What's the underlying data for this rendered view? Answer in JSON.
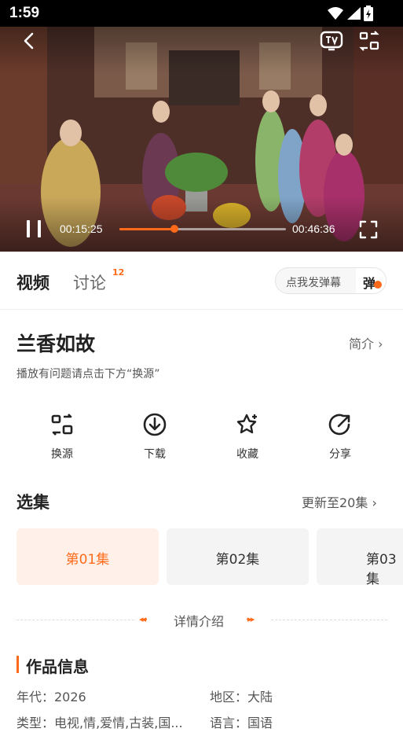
{
  "status_bar": {
    "time": "1:59"
  },
  "player": {
    "current_time": "00:15:25",
    "total_time": "00:46:36",
    "progress": 0.331,
    "accent_color": "#ff6a1a",
    "icons": [
      "back-icon",
      "tv-cast-icon",
      "switch-source-icon",
      "pause-icon",
      "fullscreen-icon"
    ]
  },
  "tabs": {
    "video": "视频",
    "discuss": "讨论",
    "discuss_count": "12"
  },
  "danmu": {
    "placeholder": "点我发弹幕",
    "toggle_label": "弹"
  },
  "show": {
    "title": "兰香如故",
    "intro_label": "简介",
    "intro_arrow": "›",
    "hint": "播放有问题请点击下方“换源”"
  },
  "actions": [
    {
      "label": "换源",
      "icon": "switch-source-icon"
    },
    {
      "label": "下载",
      "icon": "download-icon"
    },
    {
      "label": "收藏",
      "icon": "star-add-icon"
    },
    {
      "label": "分享",
      "icon": "share-icon"
    }
  ],
  "episodes": {
    "section_title": "选集",
    "update_label": "更新至20集",
    "update_arrow": "›",
    "items": [
      {
        "label": "第01集",
        "active": true
      },
      {
        "label": "第02集",
        "active": false
      },
      {
        "label": "第03集",
        "active": false
      }
    ]
  },
  "details": {
    "label": "详情介绍",
    "left_arrows": "◂◂·",
    "right_arrows": "·▸▸"
  },
  "work_info": {
    "title": "作品信息",
    "year": "年代：2026",
    "region": "地区：大陆",
    "genre": "类型：电视,情,爱情,古装,国...",
    "language": "语言：国语"
  }
}
